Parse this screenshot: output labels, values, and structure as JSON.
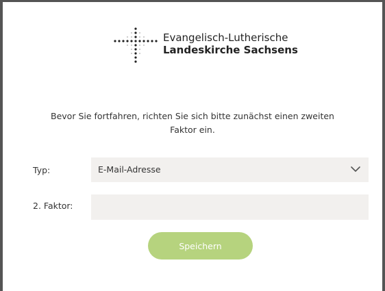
{
  "logo": {
    "icon": "cross-dots-logo-icon",
    "line1": "Evangelisch-Lutherische",
    "line2": "Landeskirche Sachsens"
  },
  "intro": "Bevor Sie fortfahren, richten Sie sich bitte zunächst einen zweiten Faktor ein.",
  "form": {
    "type_label": "Typ:",
    "type_value": "E-Mail-Adresse",
    "type_icon": "chevron-down-icon",
    "factor_label": "2. Faktor:",
    "factor_value": "",
    "factor_placeholder": ""
  },
  "save_button": {
    "label": "Speichern",
    "color": "#b6d37e"
  },
  "colors": {
    "field_bg": "#f2f0ee",
    "text": "#333333",
    "frame": "#555555"
  }
}
